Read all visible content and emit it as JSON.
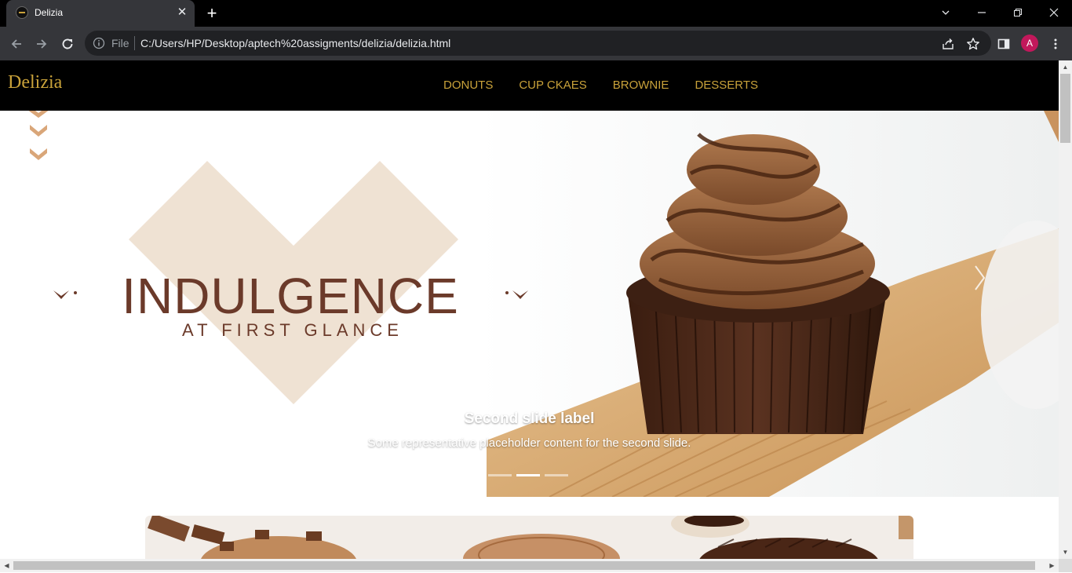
{
  "browser": {
    "tab_title": "Delizia",
    "address": {
      "scheme_label": "File",
      "url": "C:/Users/HP/Desktop/aptech%20assigments/delizia/delizia.html"
    },
    "profile_initial": "A",
    "profile_color": "#c2185b"
  },
  "site": {
    "brand": "Delizia",
    "nav": [
      {
        "label": "DONUTS"
      },
      {
        "label": "CUP CKAES"
      },
      {
        "label": "BROWNIE"
      },
      {
        "label": "DESSERTS"
      }
    ],
    "accent_color": "#c9a23a"
  },
  "hero": {
    "headline": "INDULGENCE",
    "subheadline": "AT FIRST GLANCE",
    "caption_title": "Second slide label",
    "caption_text": "Some representative placeholder content for the second slide.",
    "indicators": {
      "count": 3,
      "active_index": 1
    }
  },
  "icons": {
    "tab_close": "close-icon",
    "new_tab": "plus-icon",
    "back": "back-arrow-icon",
    "forward": "forward-arrow-icon",
    "reload": "reload-icon",
    "info": "info-icon",
    "share": "share-icon",
    "bookmark": "star-icon",
    "side_panel": "side-panel-icon",
    "menu": "kebab-menu-icon",
    "carousel_next": "chevron-right-icon"
  }
}
